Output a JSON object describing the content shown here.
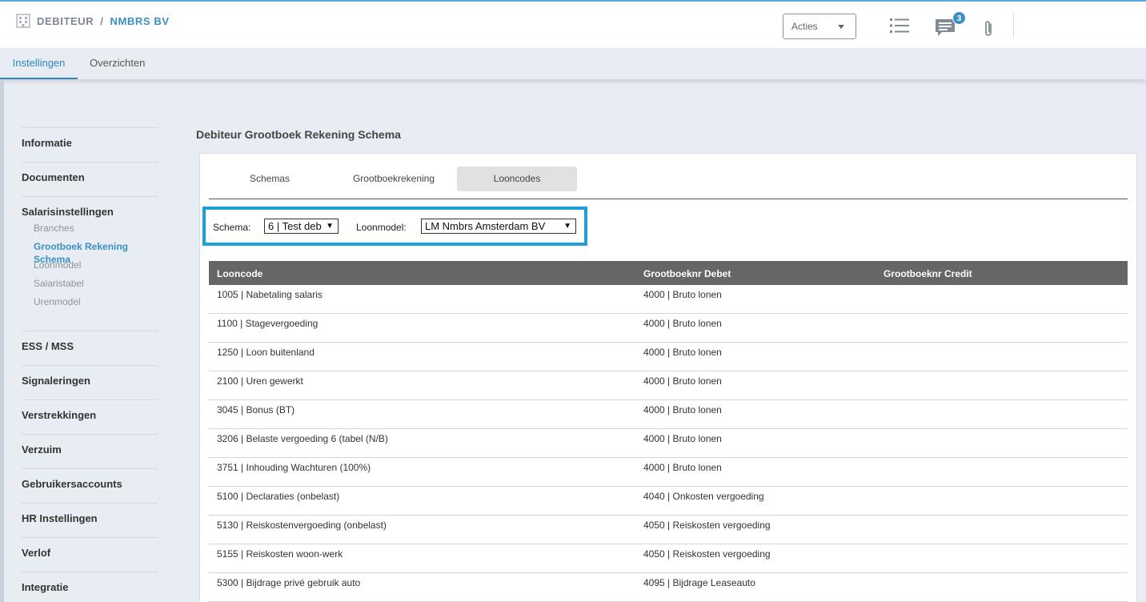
{
  "header": {
    "entity_type": "DEBITEUR",
    "separator": "/",
    "entity_name": "NMBRS BV",
    "acties_label": "Acties",
    "chat_badge": "3"
  },
  "tabs": [
    {
      "label": "Instellingen",
      "active": true
    },
    {
      "label": "Overzichten",
      "active": false
    }
  ],
  "sidebar": {
    "items": [
      {
        "label": "Informatie"
      },
      {
        "label": "Documenten"
      },
      {
        "label": "Salarisinstellingen",
        "children": [
          "Branches",
          "Grootboek Rekening Schema",
          "Loonmodel",
          "Salaristabel",
          "Urenmodel"
        ],
        "active_child": "Grootboek Rekening Schema"
      },
      {
        "label": "ESS / MSS"
      },
      {
        "label": "Signaleringen"
      },
      {
        "label": "Verstrekkingen"
      },
      {
        "label": "Verzuim"
      },
      {
        "label": "Gebruikersaccounts"
      },
      {
        "label": "HR Instellingen"
      },
      {
        "label": "Verlof"
      },
      {
        "label": "Integratie"
      }
    ]
  },
  "page_title": "Debiteur Grootboek Rekening Schema",
  "subtabs": [
    {
      "label": "Schemas"
    },
    {
      "label": "Grootboekrekening"
    },
    {
      "label": "Looncodes",
      "active": true
    }
  ],
  "filters": {
    "schema_label": "Schema:",
    "schema_value": "6 | Test deb",
    "loonmodel_label": "Loonmodel:",
    "loonmodel_value": "LM Nmbrs Amsterdam BV"
  },
  "table": {
    "columns": [
      "Looncode",
      "Grootboeknr Debet",
      "Grootboeknr Credit"
    ],
    "rows": [
      [
        "1005 | Nabetaling salaris",
        "4000 | Bruto lonen",
        ""
      ],
      [
        "1100 | Stagevergoeding",
        "4000 | Bruto lonen",
        ""
      ],
      [
        "1250 | Loon buitenland",
        "4000 | Bruto lonen",
        ""
      ],
      [
        "2100 | Uren gewerkt",
        "4000 | Bruto lonen",
        ""
      ],
      [
        "3045 | Bonus (BT)",
        "4000 | Bruto lonen",
        ""
      ],
      [
        "3206 | Belaste vergoeding 6 (tabel (N/B)",
        "4000 | Bruto lonen",
        ""
      ],
      [
        "3751 | Inhouding Wachturen (100%)",
        "4000 | Bruto lonen",
        ""
      ],
      [
        "5100 | Declaraties (onbelast)",
        "4040 | Onkosten vergoeding",
        ""
      ],
      [
        "5130 | Reiskostenvergoeding (onbelast)",
        "4050 | Reiskosten vergoeding",
        ""
      ],
      [
        "5155 | Reiskosten woon-werk",
        "4050 | Reiskosten vergoeding",
        ""
      ],
      [
        "5300 | Bijdrage privé gebruik auto",
        "4095 | Bijdrage Leaseauto",
        ""
      ]
    ]
  }
}
